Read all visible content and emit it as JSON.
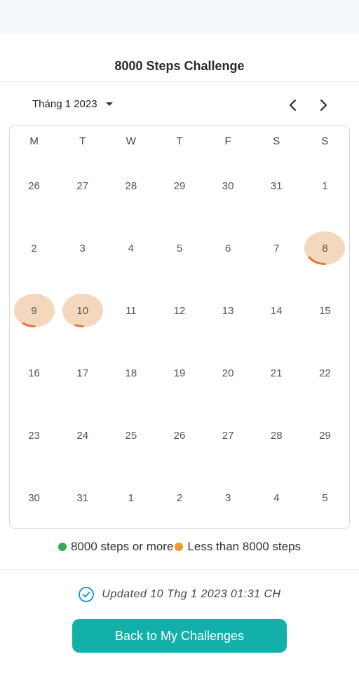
{
  "title": "8000 Steps Challenge",
  "month_picker": {
    "label": "Tháng 1 2023",
    "icon": "caret-down-icon"
  },
  "nav": {
    "prev_icon": "chevron-left-icon",
    "next_icon": "chevron-right-icon"
  },
  "weekdays": [
    "M",
    "T",
    "W",
    "T",
    "F",
    "S",
    "S"
  ],
  "weeks": [
    [
      {
        "d": "26"
      },
      {
        "d": "27"
      },
      {
        "d": "28"
      },
      {
        "d": "29"
      },
      {
        "d": "30"
      },
      {
        "d": "31"
      },
      {
        "d": "1"
      }
    ],
    [
      {
        "d": "2"
      },
      {
        "d": "3"
      },
      {
        "d": "4"
      },
      {
        "d": "5"
      },
      {
        "d": "6"
      },
      {
        "d": "7"
      },
      {
        "d": "8",
        "progress": 0.15
      }
    ],
    [
      {
        "d": "9",
        "progress": 0.1
      },
      {
        "d": "10",
        "progress": 0.06
      },
      {
        "d": "11"
      },
      {
        "d": "12"
      },
      {
        "d": "13"
      },
      {
        "d": "14"
      },
      {
        "d": "15"
      }
    ],
    [
      {
        "d": "16"
      },
      {
        "d": "17"
      },
      {
        "d": "18"
      },
      {
        "d": "19"
      },
      {
        "d": "20"
      },
      {
        "d": "21"
      },
      {
        "d": "22"
      }
    ],
    [
      {
        "d": "23"
      },
      {
        "d": "24"
      },
      {
        "d": "25"
      },
      {
        "d": "26"
      },
      {
        "d": "27"
      },
      {
        "d": "28"
      },
      {
        "d": "29"
      }
    ],
    [
      {
        "d": "30"
      },
      {
        "d": "31"
      },
      {
        "d": "1"
      },
      {
        "d": "2"
      },
      {
        "d": "3"
      },
      {
        "d": "4"
      },
      {
        "d": "5"
      }
    ]
  ],
  "legend": {
    "met_label": "8000 steps or more",
    "met_color": "#3aa65c",
    "under_label": "Less than 8000 steps",
    "under_color": "#f09a2e"
  },
  "updated_text": "Updated 10 Thg 1 2023 01:31 CH",
  "back_button_label": "Back to My Challenges",
  "colors": {
    "accent": "#13b0aa",
    "progress_bg": "#f4d8bd",
    "progress_arc": "#e8733a"
  }
}
